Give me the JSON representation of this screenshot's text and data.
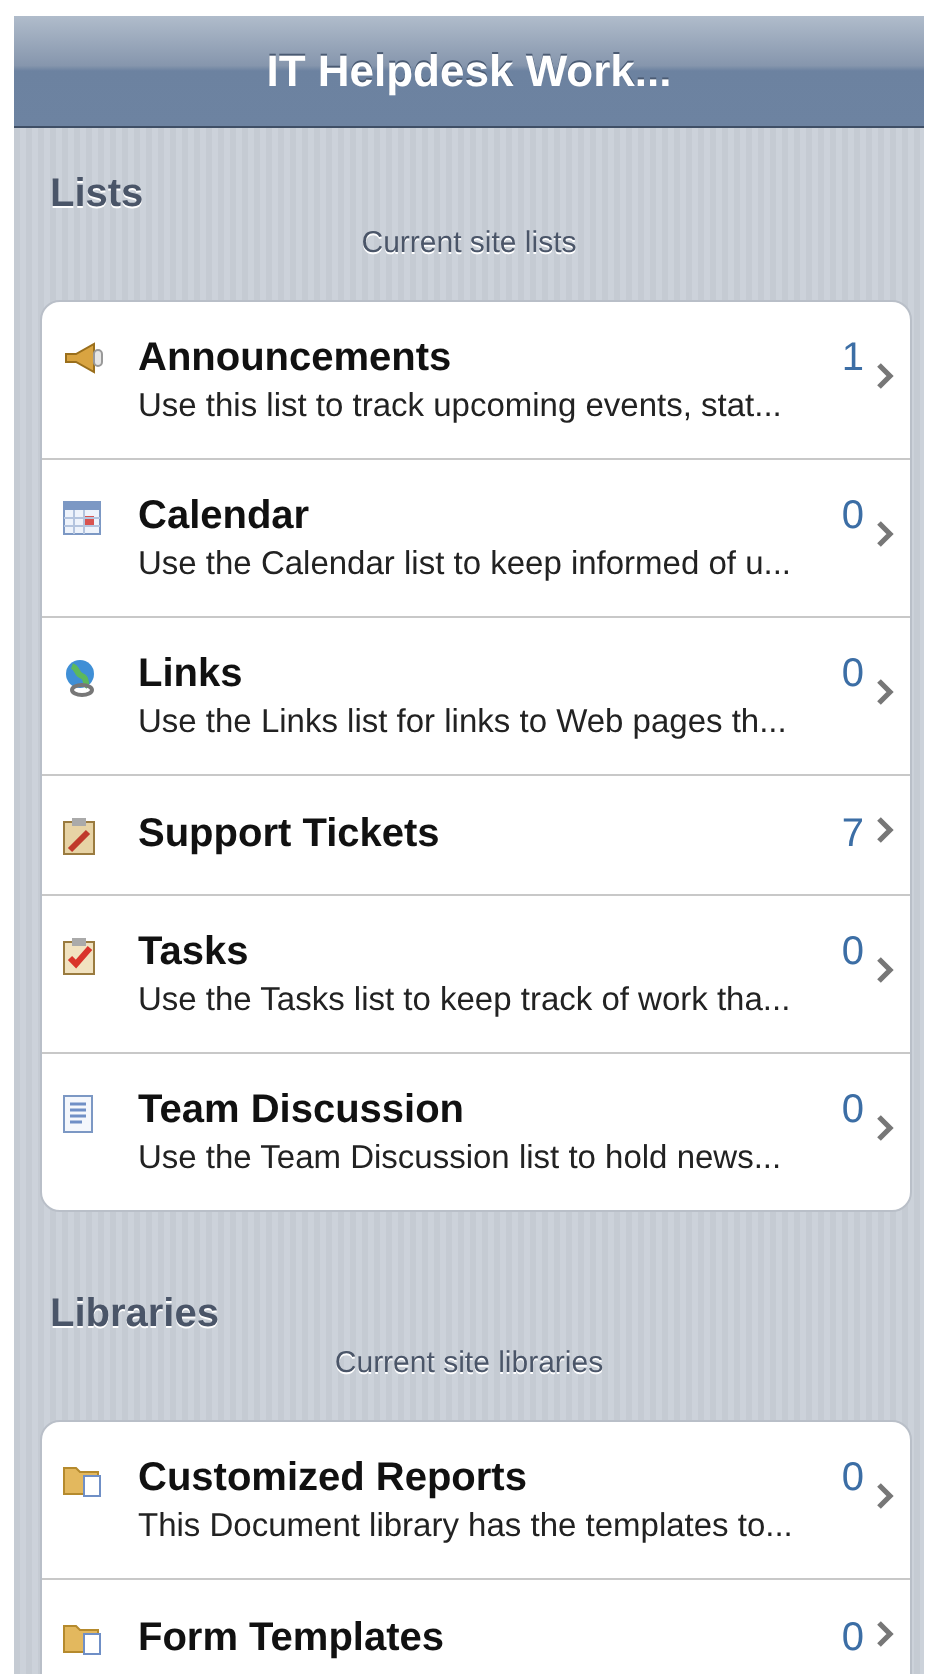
{
  "header": {
    "title": "IT Helpdesk Work..."
  },
  "sections": [
    {
      "title": "Lists",
      "subtitle": "Current site lists",
      "items": [
        {
          "name": "Announcements",
          "count": "1",
          "description": "Use this list to track upcoming events, stat..."
        },
        {
          "name": "Calendar",
          "count": "0",
          "description": "Use the Calendar list to keep informed of u..."
        },
        {
          "name": "Links",
          "count": "0",
          "description": "Use the Links list for links to Web pages th..."
        },
        {
          "name": "Support Tickets",
          "count": "7"
        },
        {
          "name": "Tasks",
          "count": "0",
          "description": "Use the Tasks list to keep track of work tha..."
        },
        {
          "name": "Team Discussion",
          "count": "0",
          "description": "Use the Team Discussion list to hold news..."
        }
      ]
    },
    {
      "title": "Libraries",
      "subtitle": "Current site libraries",
      "items": [
        {
          "name": "Customized Reports",
          "count": "0",
          "description": "This Document library has the templates to..."
        },
        {
          "name": "Form Templates",
          "count": "0"
        }
      ]
    }
  ]
}
